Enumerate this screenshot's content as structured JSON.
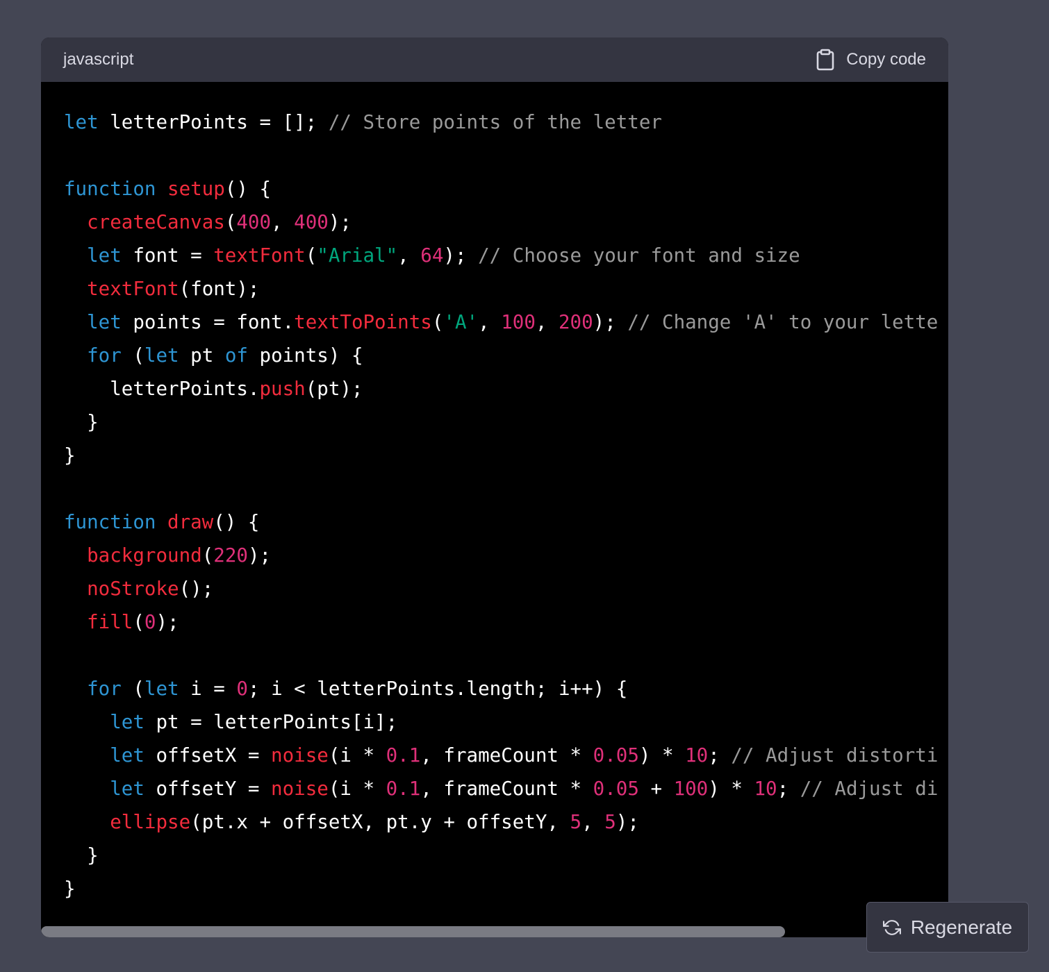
{
  "code_block": {
    "language": "javascript",
    "copy_label": "Copy code",
    "lines": [
      [
        [
          "keyword",
          "let"
        ],
        [
          "plain",
          " letterPoints = []; "
        ],
        [
          "comment",
          "// Store points of the letter"
        ]
      ],
      [],
      [
        [
          "keyword",
          "function"
        ],
        [
          "plain",
          " "
        ],
        [
          "func",
          "setup"
        ],
        [
          "plain",
          "() {"
        ]
      ],
      [
        [
          "plain",
          "  "
        ],
        [
          "func",
          "createCanvas"
        ],
        [
          "plain",
          "("
        ],
        [
          "num",
          "400"
        ],
        [
          "plain",
          ", "
        ],
        [
          "num",
          "400"
        ],
        [
          "plain",
          ");"
        ]
      ],
      [
        [
          "plain",
          "  "
        ],
        [
          "keyword",
          "let"
        ],
        [
          "plain",
          " font = "
        ],
        [
          "func",
          "textFont"
        ],
        [
          "plain",
          "("
        ],
        [
          "str",
          "\"Arial\""
        ],
        [
          "plain",
          ", "
        ],
        [
          "num",
          "64"
        ],
        [
          "plain",
          "); "
        ],
        [
          "comment",
          "// Choose your font and size"
        ]
      ],
      [
        [
          "plain",
          "  "
        ],
        [
          "func",
          "textFont"
        ],
        [
          "plain",
          "(font);"
        ]
      ],
      [
        [
          "plain",
          "  "
        ],
        [
          "keyword",
          "let"
        ],
        [
          "plain",
          " points = font."
        ],
        [
          "func",
          "textToPoints"
        ],
        [
          "plain",
          "("
        ],
        [
          "str",
          "'A'"
        ],
        [
          "plain",
          ", "
        ],
        [
          "num",
          "100"
        ],
        [
          "plain",
          ", "
        ],
        [
          "num",
          "200"
        ],
        [
          "plain",
          "); "
        ],
        [
          "comment",
          "// Change 'A' to your lette"
        ]
      ],
      [
        [
          "plain",
          "  "
        ],
        [
          "keyword",
          "for"
        ],
        [
          "plain",
          " ("
        ],
        [
          "keyword",
          "let"
        ],
        [
          "plain",
          " pt "
        ],
        [
          "keyword",
          "of"
        ],
        [
          "plain",
          " points) {"
        ]
      ],
      [
        [
          "plain",
          "    letterPoints."
        ],
        [
          "func",
          "push"
        ],
        [
          "plain",
          "(pt);"
        ]
      ],
      [
        [
          "plain",
          "  }"
        ]
      ],
      [
        [
          "plain",
          "}"
        ]
      ],
      [],
      [
        [
          "keyword",
          "function"
        ],
        [
          "plain",
          " "
        ],
        [
          "func",
          "draw"
        ],
        [
          "plain",
          "() {"
        ]
      ],
      [
        [
          "plain",
          "  "
        ],
        [
          "func",
          "background"
        ],
        [
          "plain",
          "("
        ],
        [
          "num",
          "220"
        ],
        [
          "plain",
          ");"
        ]
      ],
      [
        [
          "plain",
          "  "
        ],
        [
          "func",
          "noStroke"
        ],
        [
          "plain",
          "();"
        ]
      ],
      [
        [
          "plain",
          "  "
        ],
        [
          "func",
          "fill"
        ],
        [
          "plain",
          "("
        ],
        [
          "num",
          "0"
        ],
        [
          "plain",
          ");"
        ]
      ],
      [],
      [
        [
          "plain",
          "  "
        ],
        [
          "keyword",
          "for"
        ],
        [
          "plain",
          " ("
        ],
        [
          "keyword",
          "let"
        ],
        [
          "plain",
          " i = "
        ],
        [
          "num",
          "0"
        ],
        [
          "plain",
          "; i < letterPoints.length; i++) {"
        ]
      ],
      [
        [
          "plain",
          "    "
        ],
        [
          "keyword",
          "let"
        ],
        [
          "plain",
          " pt = letterPoints[i];"
        ]
      ],
      [
        [
          "plain",
          "    "
        ],
        [
          "keyword",
          "let"
        ],
        [
          "plain",
          " offsetX = "
        ],
        [
          "func",
          "noise"
        ],
        [
          "plain",
          "(i * "
        ],
        [
          "num",
          "0.1"
        ],
        [
          "plain",
          ", frameCount * "
        ],
        [
          "num",
          "0.05"
        ],
        [
          "plain",
          ") * "
        ],
        [
          "num",
          "10"
        ],
        [
          "plain",
          "; "
        ],
        [
          "comment",
          "// Adjust distorti"
        ]
      ],
      [
        [
          "plain",
          "    "
        ],
        [
          "keyword",
          "let"
        ],
        [
          "plain",
          " offsetY = "
        ],
        [
          "func",
          "noise"
        ],
        [
          "plain",
          "(i * "
        ],
        [
          "num",
          "0.1"
        ],
        [
          "plain",
          ", frameCount * "
        ],
        [
          "num",
          "0.05"
        ],
        [
          "plain",
          " + "
        ],
        [
          "num",
          "100"
        ],
        [
          "plain",
          ") * "
        ],
        [
          "num",
          "10"
        ],
        [
          "plain",
          "; "
        ],
        [
          "comment",
          "// Adjust di"
        ]
      ],
      [
        [
          "plain",
          "    "
        ],
        [
          "func",
          "ellipse"
        ],
        [
          "plain",
          "(pt.x + offsetX, pt.y + offsetY, "
        ],
        [
          "num",
          "5"
        ],
        [
          "plain",
          ", "
        ],
        [
          "num",
          "5"
        ],
        [
          "plain",
          ");"
        ]
      ],
      [
        [
          "plain",
          "  }"
        ]
      ],
      [
        [
          "plain",
          "}"
        ]
      ]
    ],
    "horizontal_scroll_fraction": 0.82
  },
  "regenerate": {
    "label": "Regenerate",
    "icon": "refresh-icon"
  },
  "colors": {
    "page_bg": "#444654",
    "header_bg": "#343541",
    "code_bg": "#000000",
    "keyword": "#2e95d3",
    "function": "#f22c3d",
    "number": "#df3079",
    "string": "#00a67d",
    "comment": "#9a9a9a"
  }
}
